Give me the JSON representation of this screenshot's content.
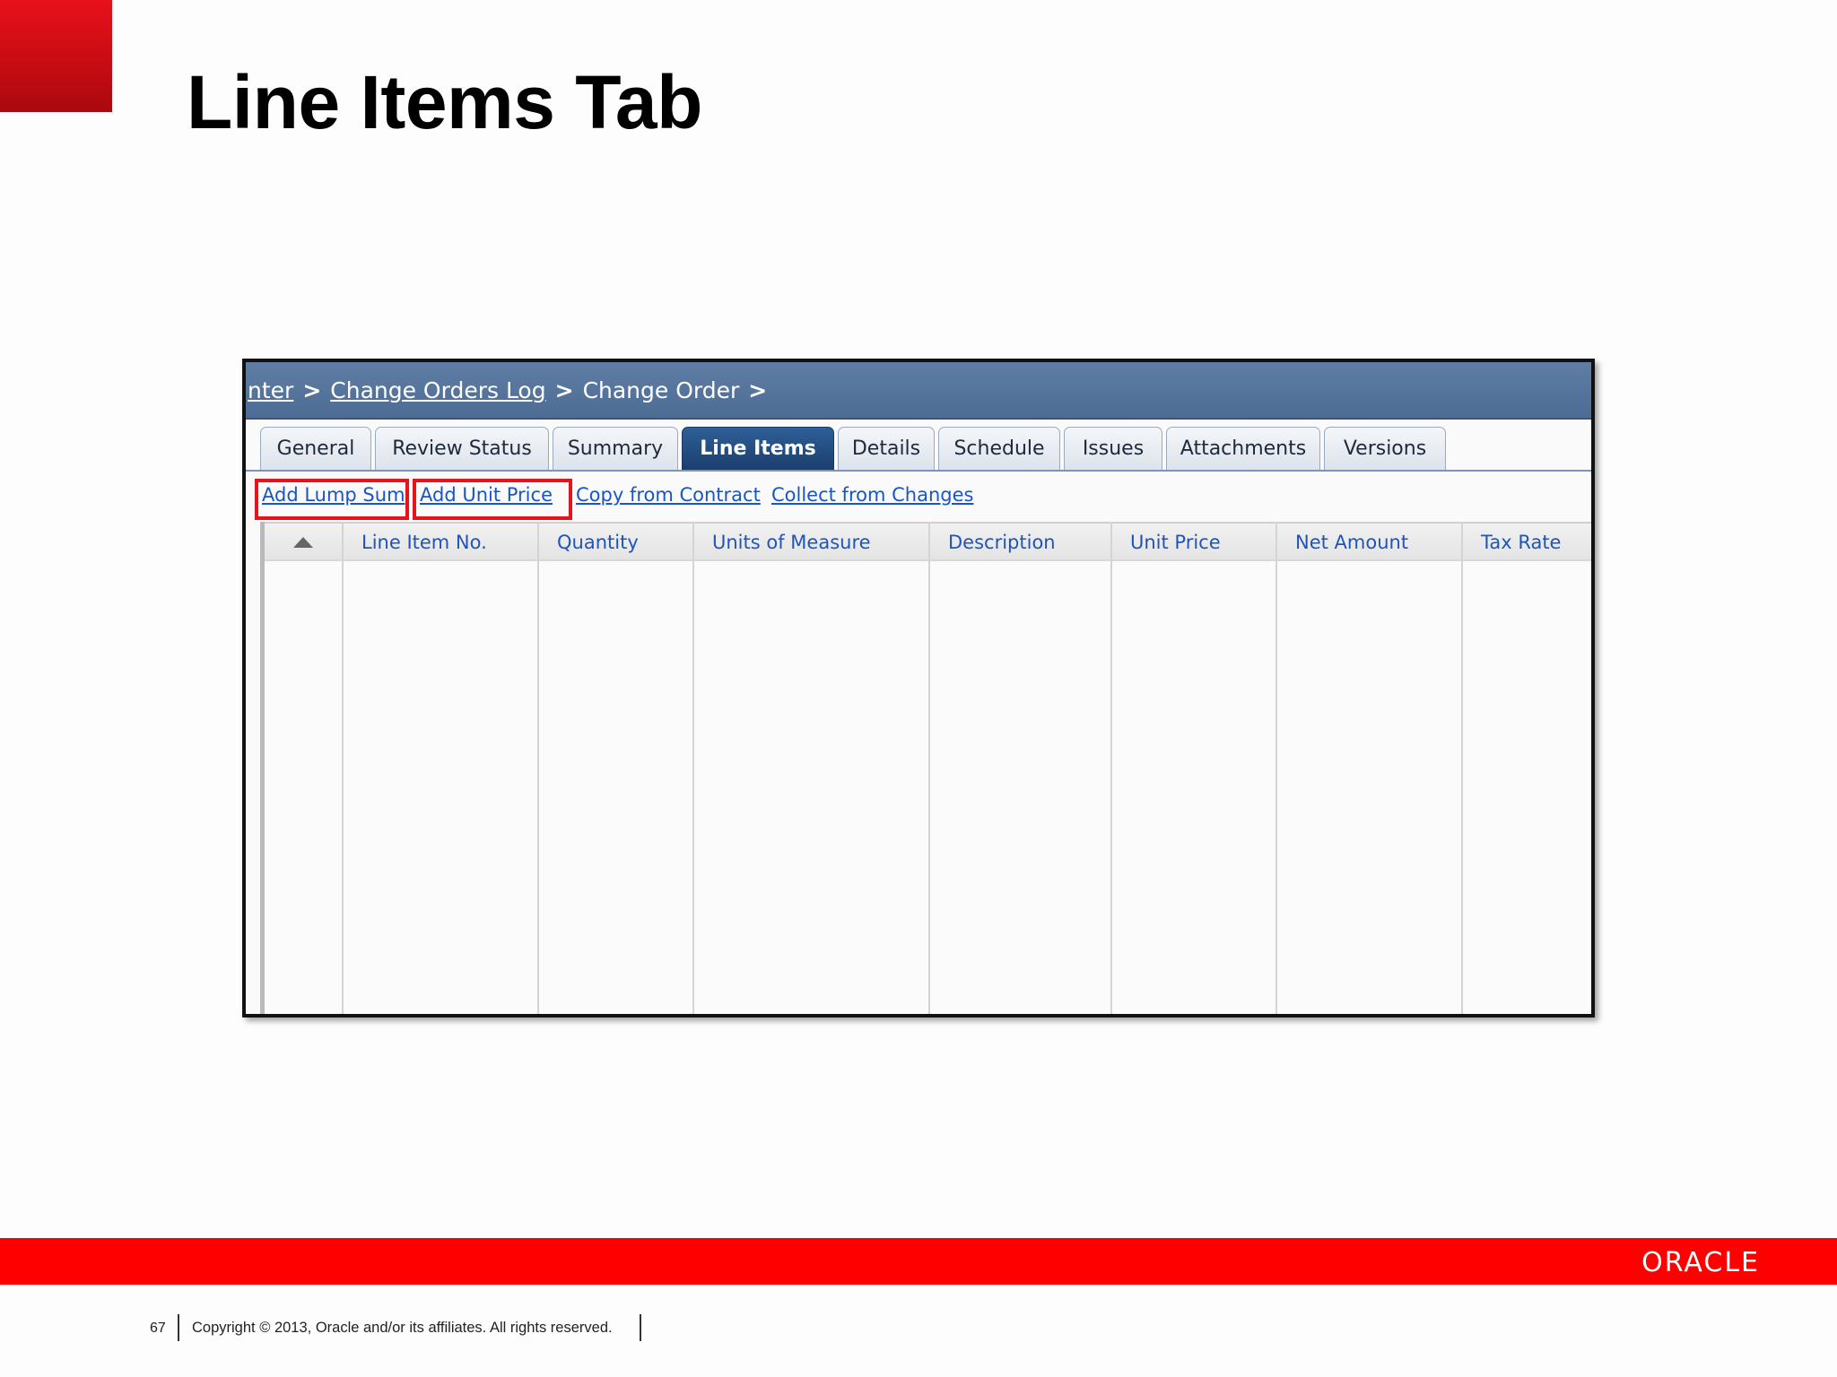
{
  "slide": {
    "title": "Line Items Tab",
    "page_number": "67",
    "copyright": "Copyright © 2013, Oracle and/or its affiliates. All rights reserved.",
    "logo_text": "ORACLE"
  },
  "breadcrumb": {
    "items": [
      {
        "label": "nter",
        "link": true
      },
      {
        "label": "Change Orders Log",
        "link": true
      },
      {
        "label": "Change Order",
        "link": false
      }
    ],
    "separator": ">"
  },
  "tabs": [
    {
      "label": "General",
      "active": false
    },
    {
      "label": "Review Status",
      "active": false
    },
    {
      "label": "Summary",
      "active": false
    },
    {
      "label": "Line Items",
      "active": true
    },
    {
      "label": "Details",
      "active": false
    },
    {
      "label": "Schedule",
      "active": false
    },
    {
      "label": "Issues",
      "active": false
    },
    {
      "label": "Attachments",
      "active": false
    },
    {
      "label": "Versions",
      "active": false
    }
  ],
  "actions": [
    {
      "label": "Add Lump Sum",
      "highlighted": true
    },
    {
      "label": "Add Unit Price",
      "highlighted": true
    },
    {
      "label": "Copy from Contract",
      "highlighted": false
    },
    {
      "label": "Collect from Changes",
      "highlighted": false
    }
  ],
  "table": {
    "columns": [
      "Line Item No.",
      "Quantity",
      "Units of Measure",
      "Description",
      "Unit Price",
      "Net Amount",
      "Tax Rate"
    ],
    "sort_indicator": "sort-ascending-icon",
    "rows": []
  },
  "colors": {
    "brand_red": "#ff0000",
    "header_blue": "#4d6c94",
    "active_tab": "#1a3f6e",
    "link_blue": "#1a55c4",
    "highlight_red": "#e8121a"
  }
}
